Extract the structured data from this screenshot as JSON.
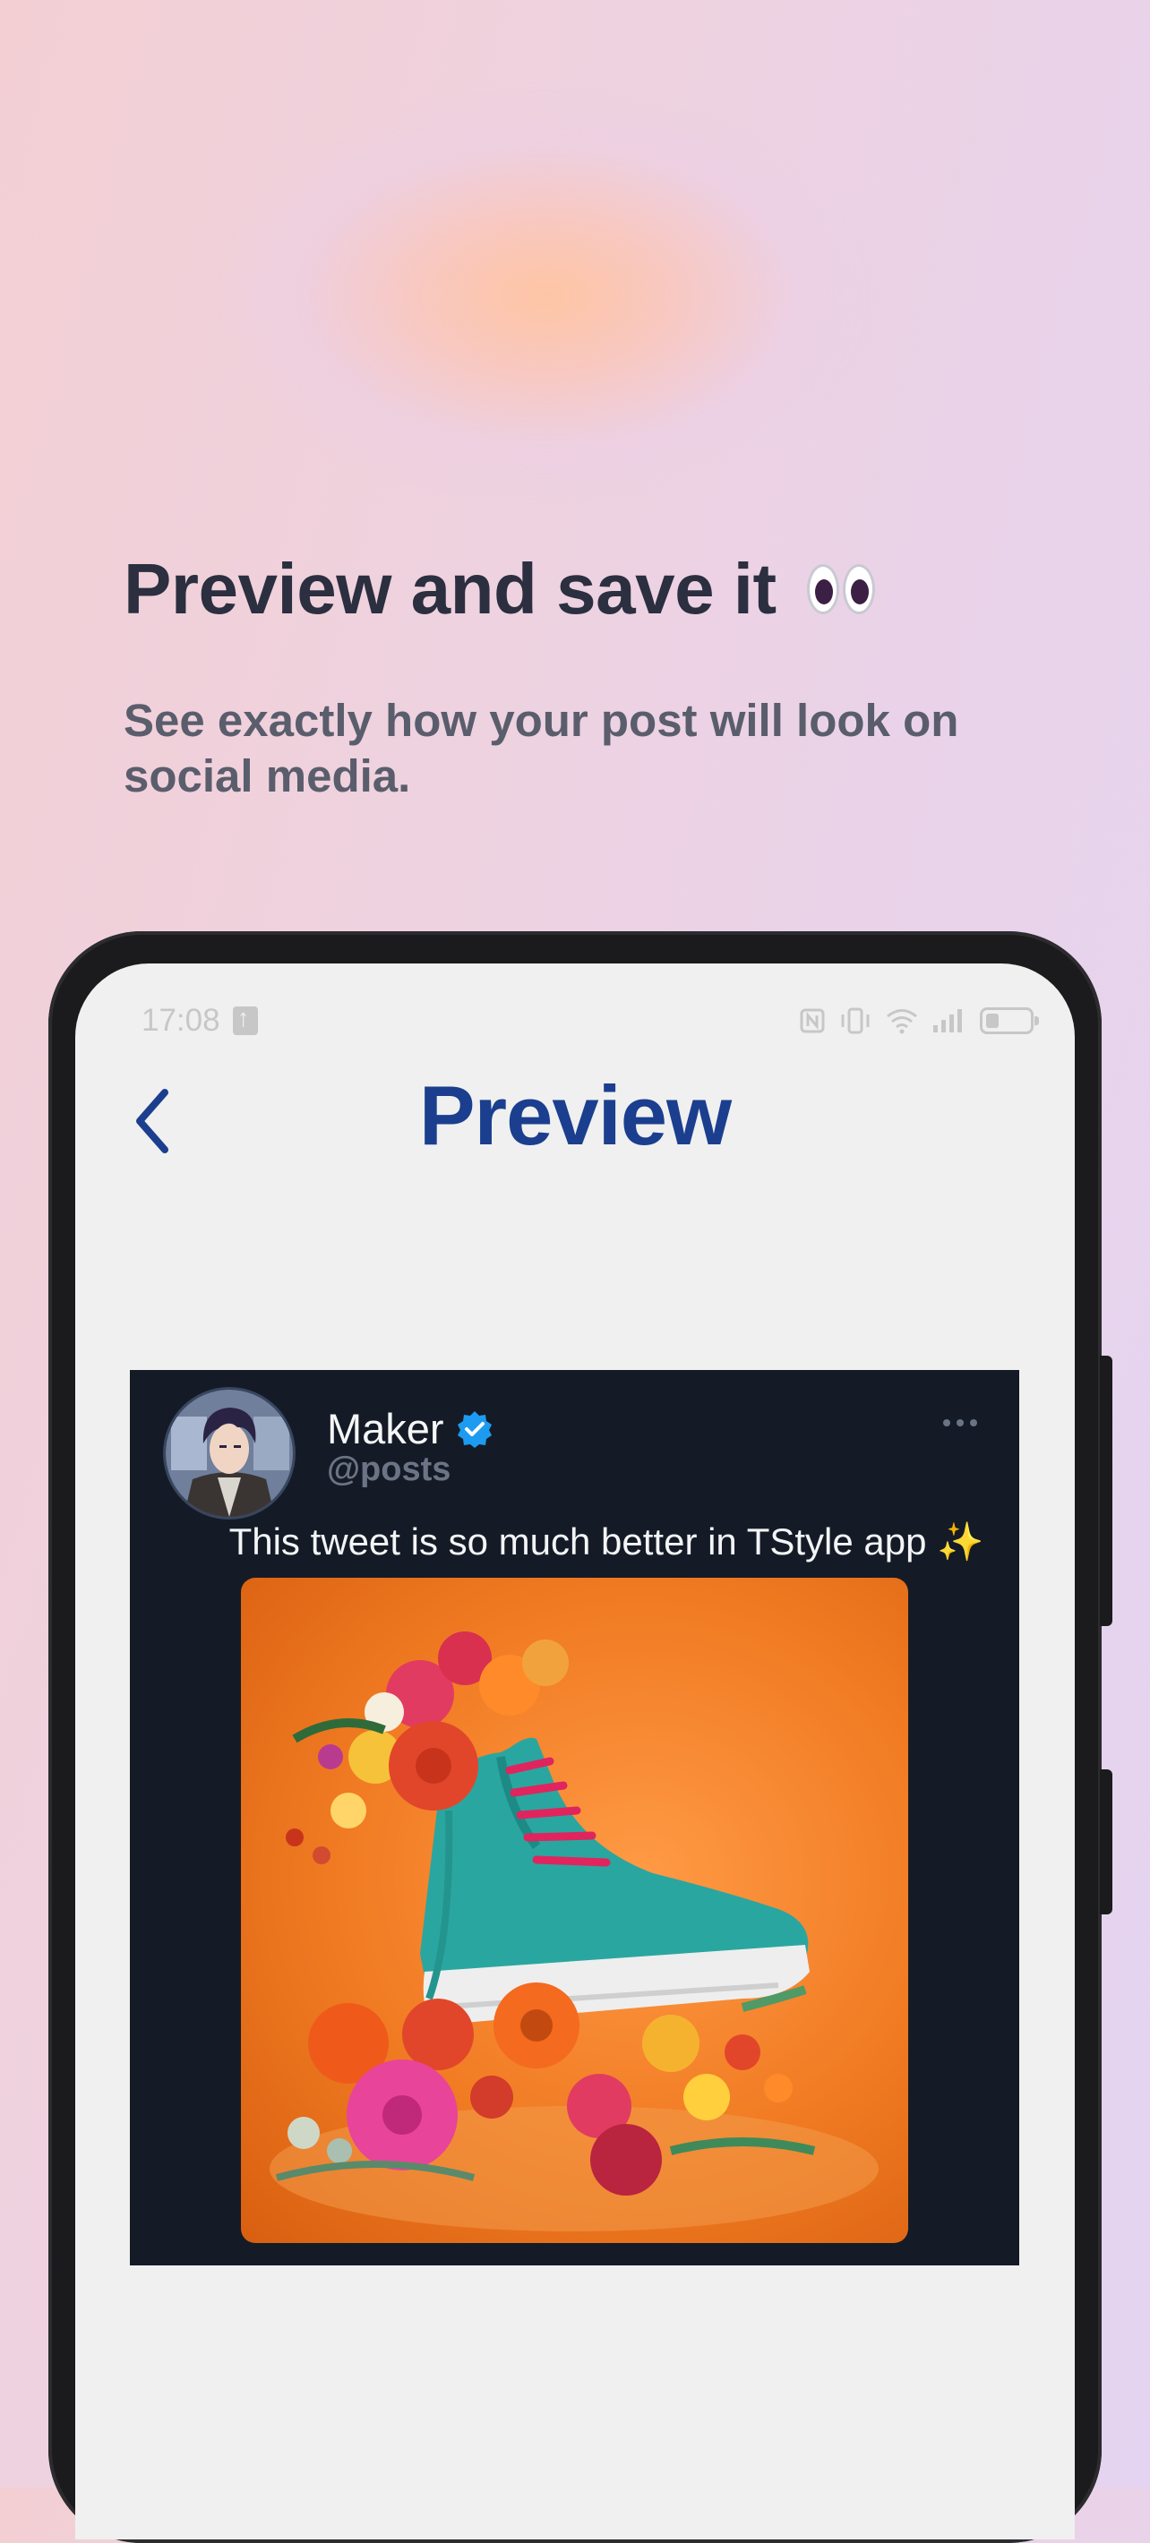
{
  "promo": {
    "headline": "Preview and save it",
    "headline_icon": "eyes-emoji",
    "subtitle": "See exactly how your post will look on social media."
  },
  "status_bar": {
    "time": "17:08",
    "icons": [
      "upload-icon",
      "nfc-icon",
      "vibrate-icon",
      "wifi-icon",
      "signal-icon",
      "battery-icon"
    ]
  },
  "app": {
    "title": "Preview",
    "back_icon": "chevron-left-icon",
    "accent": "#1b3f8e"
  },
  "tweet": {
    "display_name": "Maker",
    "verified": true,
    "handle": "@posts",
    "text": "This tweet is so much better in TStyle app ✨",
    "media": "orange-sneaker-flowers-photo",
    "background": "#141b26",
    "more_icon": "more-horizontal-icon"
  }
}
